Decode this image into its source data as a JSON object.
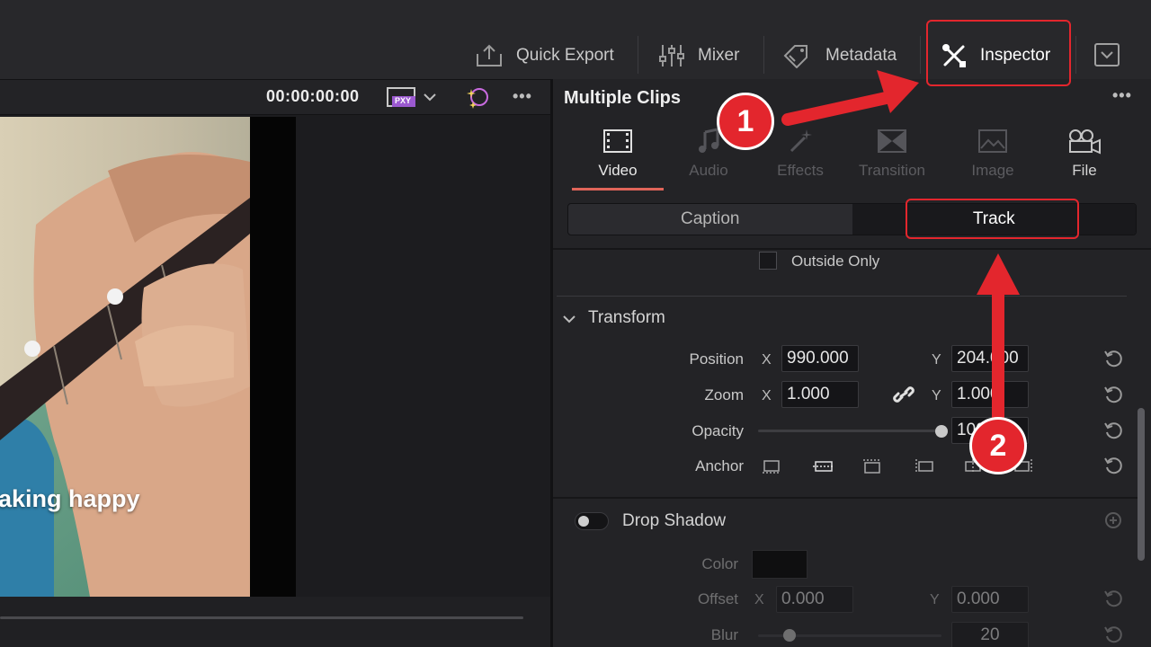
{
  "toolbar": {
    "quick_export": "Quick Export",
    "mixer": "Mixer",
    "metadata": "Metadata",
    "inspector": "Inspector"
  },
  "viewer": {
    "timecode": "00:00:00:00",
    "proxy_badge": "PXY",
    "subtitle": "aking happy"
  },
  "inspector": {
    "title": "Multiple Clips",
    "tabs": [
      {
        "label": "Video",
        "icon": "film-icon",
        "state": "active"
      },
      {
        "label": "Audio",
        "icon": "music-note-icon",
        "state": "disabled"
      },
      {
        "label": "Effects",
        "icon": "magic-wand-icon",
        "state": "disabled"
      },
      {
        "label": "Transition",
        "icon": "transition-icon",
        "state": "disabled"
      },
      {
        "label": "Image",
        "icon": "image-icon",
        "state": "disabled"
      },
      {
        "label": "File",
        "icon": "file-reel-icon",
        "state": "enabled"
      }
    ],
    "subtabs": {
      "caption": "Caption",
      "track": "Track",
      "selected": "Track"
    },
    "outside_only": "Outside Only",
    "transform": {
      "title": "Transform",
      "position_label": "Position",
      "position_x": "990.000",
      "position_y": "204.000",
      "zoom_label": "Zoom",
      "zoom_x": "1.000",
      "zoom_y": "1.000",
      "opacity_label": "Opacity",
      "opacity_value": "100",
      "opacity_level": 1.0,
      "anchor_label": "Anchor",
      "x_axis": "X",
      "y_axis": "Y"
    },
    "drop_shadow": {
      "title": "Drop Shadow",
      "color_label": "Color",
      "color_value": "#0f0f10",
      "offset_label": "Offset",
      "offset_x": "0.000",
      "offset_y": "0.000",
      "blur_label": "Blur",
      "blur_value": "20",
      "x_axis": "X",
      "y_axis": "Y"
    }
  },
  "annotations": {
    "step1": "1",
    "step2": "2",
    "color": "#e3262d"
  }
}
